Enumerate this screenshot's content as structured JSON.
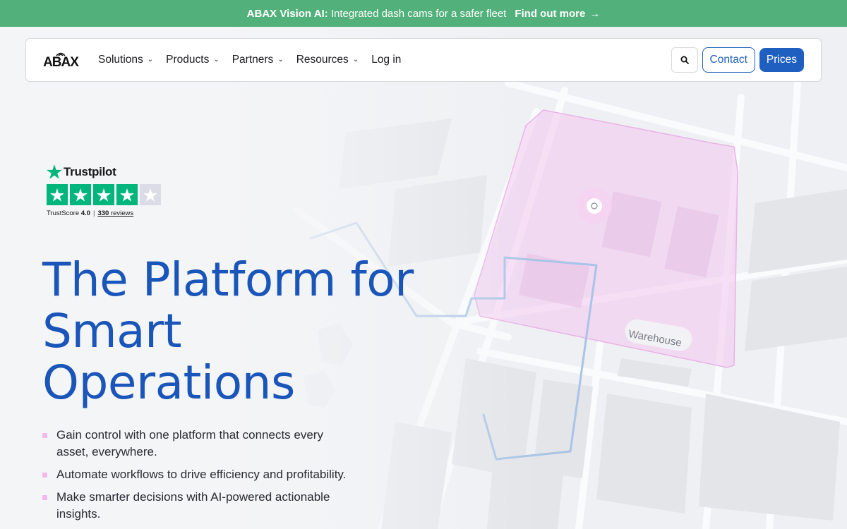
{
  "announcement": {
    "brand": "ABAX Vision AI:",
    "text": "Integrated dash cams for a safer fleet",
    "cta": "Find out more",
    "cta_icon": "arrow-right-icon",
    "background": "#52b07a"
  },
  "header": {
    "logo_text": "ABAX",
    "nav": [
      {
        "label": "Solutions",
        "has_dropdown": true
      },
      {
        "label": "Products",
        "has_dropdown": true
      },
      {
        "label": "Partners",
        "has_dropdown": true
      },
      {
        "label": "Resources",
        "has_dropdown": true
      },
      {
        "label": "Log in",
        "has_dropdown": false
      }
    ],
    "search_icon": "search-icon",
    "contact_label": "Contact",
    "prices_label": "Prices",
    "accent": "#1f5fbf"
  },
  "trustpilot": {
    "brand": "Trustpilot",
    "score_label": "TrustScore",
    "score": "4.0",
    "separator": "|",
    "reviews_count": "330",
    "reviews_label": "reviews",
    "stars_filled": 4,
    "stars_total": 5,
    "star_color": "#00b67a"
  },
  "hero": {
    "title_line1": "The Platform for",
    "title_line2": "Smart",
    "title_line3": "Operations",
    "title_color": "#1a55b9",
    "bullets": [
      "Gain control with one platform that connects every asset, everywhere.",
      "Automate workflows to drive efficiency and profitability.",
      "Make smarter decisions with AI-powered actionable insights."
    ]
  },
  "map": {
    "zone_label": "Warehouse",
    "zone_color": "#f3c6ef",
    "route_color": "#a9c4e6"
  }
}
